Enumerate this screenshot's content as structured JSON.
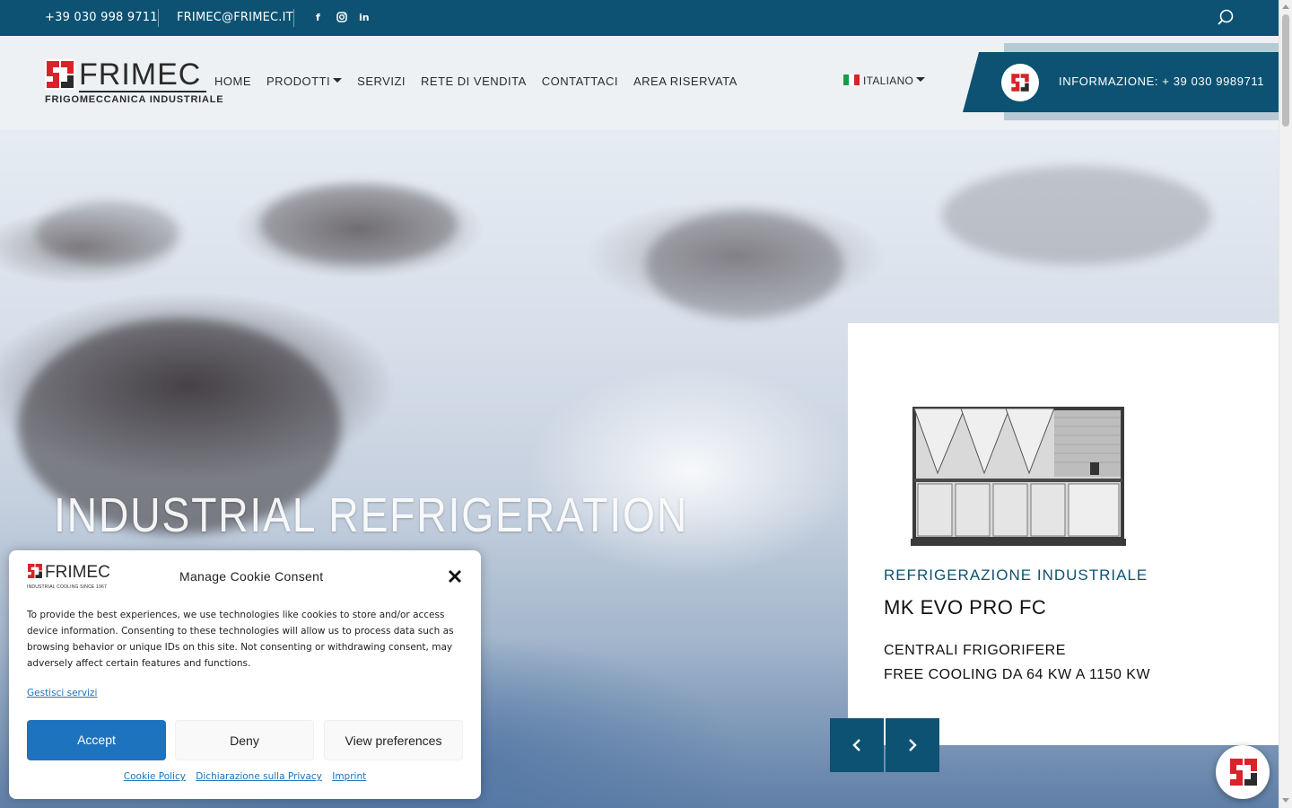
{
  "topbar": {
    "phone": "+39 030 998 9711",
    "email": "FRIMEC@FRIMEC.IT",
    "social": {
      "facebook": "f",
      "instagram": "instagram-icon",
      "linkedin": "in"
    }
  },
  "header": {
    "logo": {
      "brand": "FRIMEC",
      "tagline": "FRIGOMECCANICA INDUSTRIALE"
    },
    "nav": [
      "HOME",
      "PRODOTTI",
      "SERVIZI",
      "RETE DI VENDITA",
      "CONTATTACI",
      "AREA RISERVATA"
    ],
    "language": "ITALIANO",
    "info": "INFORMAZIONE: + 39 030 9989711"
  },
  "hero": {
    "title": "INDUSTRIAL REFRIGERATION"
  },
  "product": {
    "category": "REFRIGERAZIONE INDUSTRIALE",
    "name": "MK EVO PRO FC",
    "line1": "CENTRALI FRIGORIFERE",
    "line2": "FREE COOLING DA 64 KW A 1150 KW"
  },
  "cookie": {
    "logo_brand": "FRIMEC",
    "logo_tagline": "INDUSTRIAL COOLING SINCE 1967",
    "title": "Manage Cookie Consent",
    "body": "To provide the best experiences, we use technologies like cookies to store and/or access device information. Consenting to these technologies will allow us to process data such as browsing behavior or unique IDs on this site. Not consenting or withdrawing consent, may adversely affect certain features and functions.",
    "manage_link": "Gestisci servizi",
    "accept": "Accept",
    "deny": "Deny",
    "preferences": "View preferences",
    "links": [
      "Cookie Policy",
      "Dichiarazione sulla Privacy",
      "Imprint"
    ]
  },
  "colors": {
    "brand_blue": "#0d5272",
    "brand_red": "#d8232a",
    "accept_blue": "#1e73be"
  }
}
